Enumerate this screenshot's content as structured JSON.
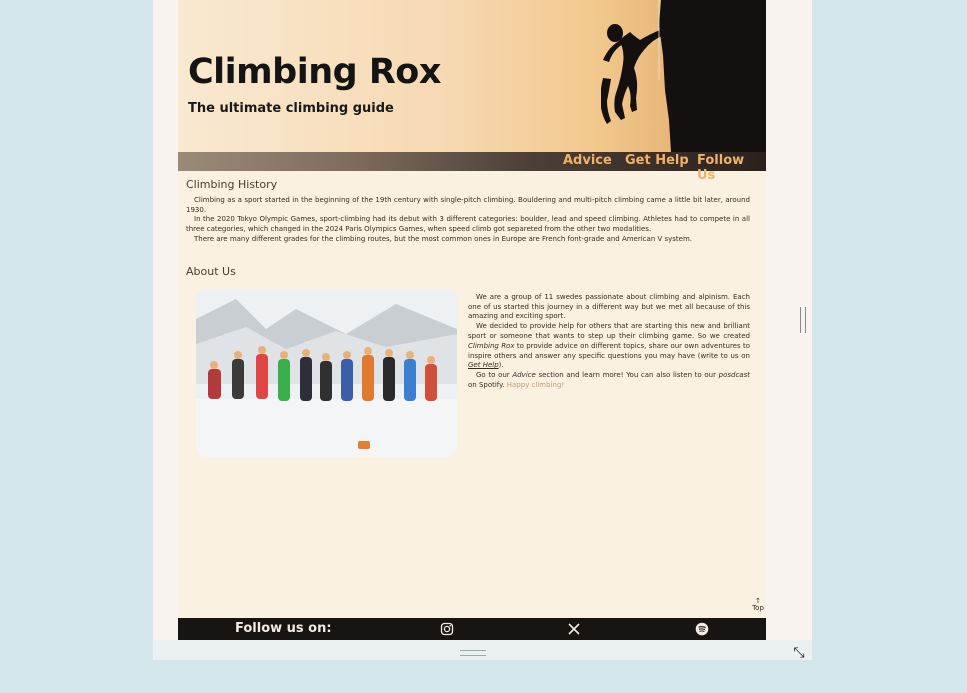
{
  "site": {
    "title": "Climbing Rox",
    "subtitle": "The ultimate climbing guide"
  },
  "nav": {
    "items": [
      {
        "label": "Advice"
      },
      {
        "label": "Get Help"
      },
      {
        "label": "Follow Us"
      }
    ]
  },
  "history": {
    "heading": "Climbing History",
    "p1": "Climbing as a sport started in the beginning of the 19th century with single-pitch climbing. Bouldering and multi-pitch climbing came a little bit later, around 1930.",
    "p2": "In the 2020 Tokyo Olympic Games, sport-climbing had its debut with 3 different categories: boulder, lead and speed climbing. Athletes had to compete in all three categories, which changed in the 2024 Paris Olympics Games, when speed climb got separeted from the other two modalities.",
    "p3": "There are many different grades for the climbing routes, but the most common ones in Europe are French font-grade and American V system."
  },
  "about": {
    "heading": "About Us",
    "p1": "We are a group of 11 swedes passionate about climbing and alpinism. Each one of us started this journey in a different way but we met all because of this amazing and exciting sport.",
    "p2_a": "We decided to provide help for others that are starting this new and brilliant sport or someone that wants to step up their climbing game. So we created ",
    "p2_em": "Climbing Rox",
    "p2_b": " to provide advice on different topics, share our own adventures to inspire others and answer any specific questions you may have (write to us on ",
    "p2_link": "Get Help",
    "p2_c": ").",
    "p3_a": "Go to our ",
    "p3_em1": "Advice",
    "p3_b": " section and learn more! You can also listen to our ",
    "p3_em2": "posdcast",
    "p3_c": " on Spotify. ",
    "p3_happy": "Happy climbing!"
  },
  "top_link": {
    "arrow": "↑",
    "label": "Top"
  },
  "footer": {
    "label": "Follow us on:",
    "icons": [
      "instagram-icon",
      "x-icon",
      "spotify-icon"
    ]
  },
  "colors": {
    "nav_link": "#f2b165",
    "footer_bg": "#171411",
    "page_bg": "#faf1e1",
    "outer_bg": "#d3e6e9"
  }
}
